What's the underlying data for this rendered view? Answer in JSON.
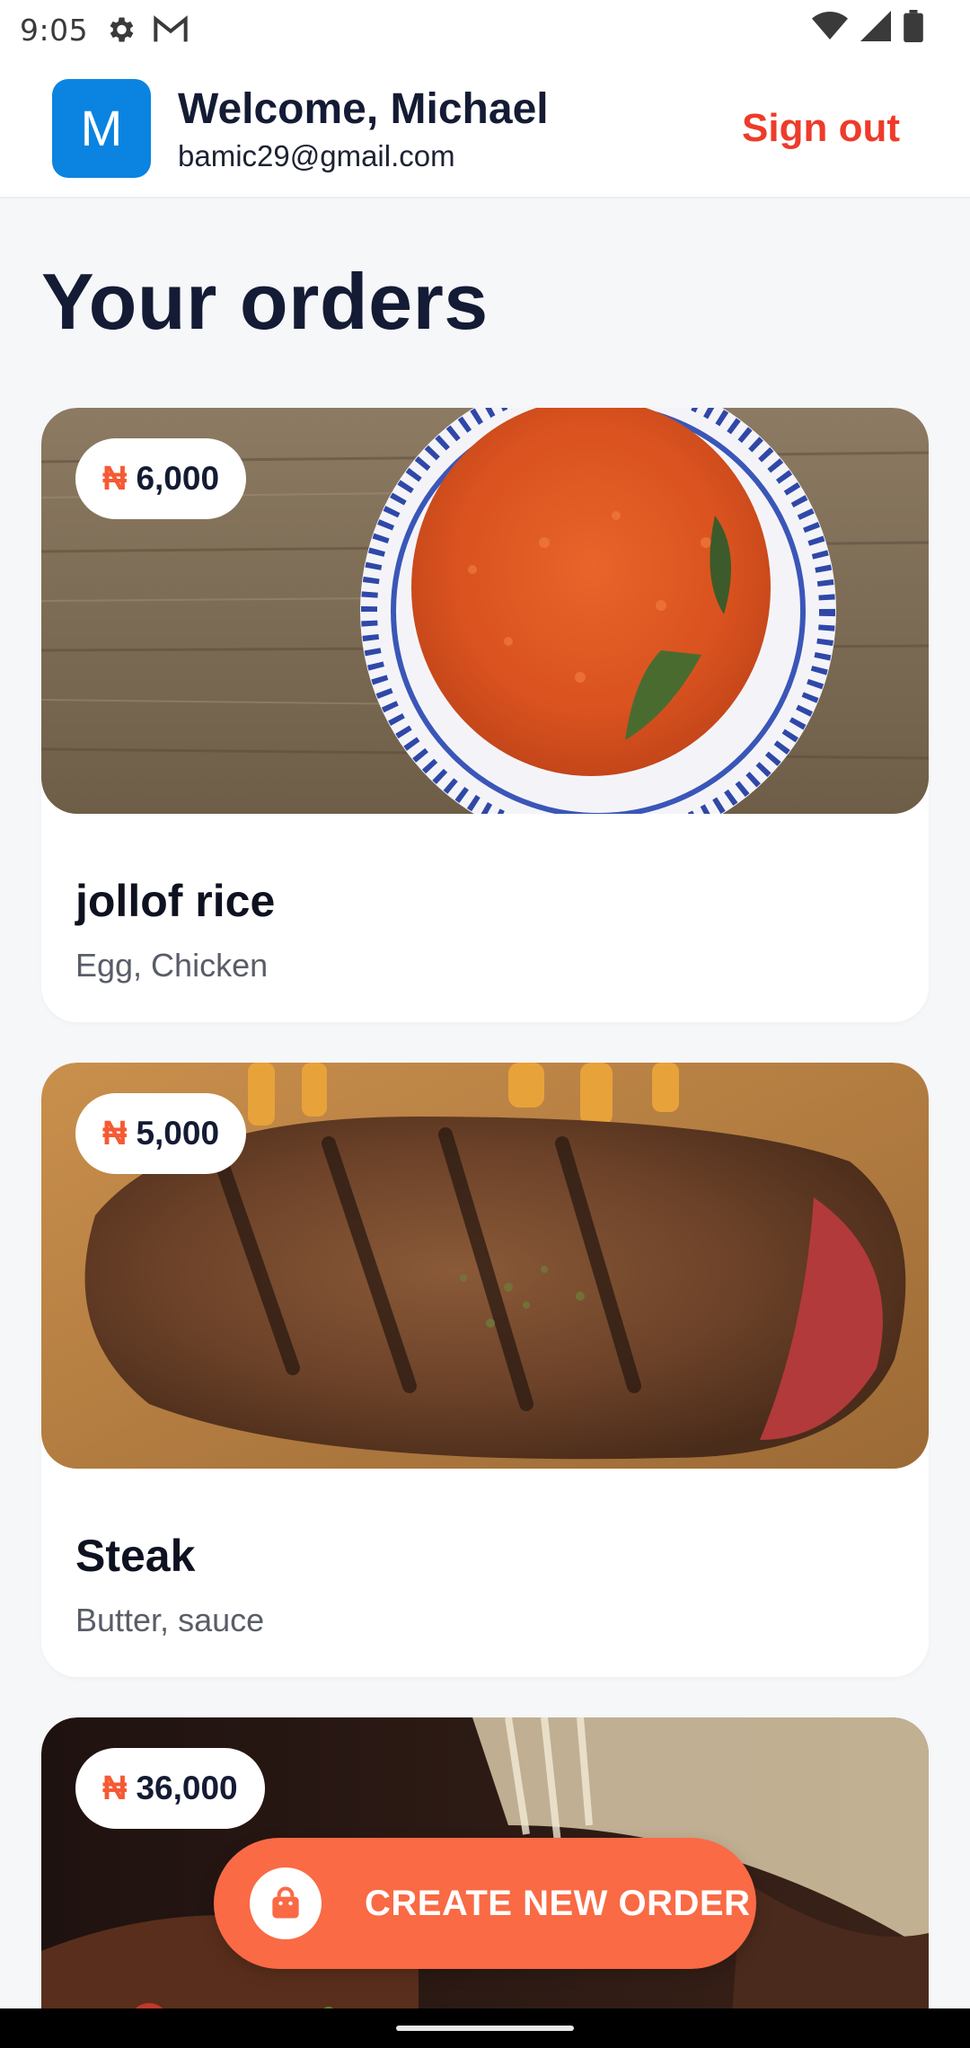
{
  "status_bar": {
    "time": "9:05",
    "left_icons": [
      "gear-icon",
      "gmail-icon"
    ],
    "right_icons": [
      "wifi-icon",
      "cellular-icon",
      "battery-icon"
    ]
  },
  "header": {
    "avatar_letter": "M",
    "welcome": "Welcome, Michael",
    "email": "bamic29@gmail.com",
    "sign_out": "Sign out",
    "avatar_color": "#0a84e0",
    "accent_color": "#ee3b2a"
  },
  "page": {
    "title": "Your orders"
  },
  "orders": [
    {
      "currency": "₦",
      "price": "6,000",
      "name": "jollof rice",
      "desc": "Egg, Chicken"
    },
    {
      "currency": "₦",
      "price": "5,000",
      "name": "Steak",
      "desc": "Butter, sauce"
    },
    {
      "currency": "₦",
      "price": "36,000"
    }
  ],
  "fab": {
    "label": "CREATE NEW ORDER",
    "icon": "shopping-bag-icon",
    "color": "#f96a45"
  }
}
